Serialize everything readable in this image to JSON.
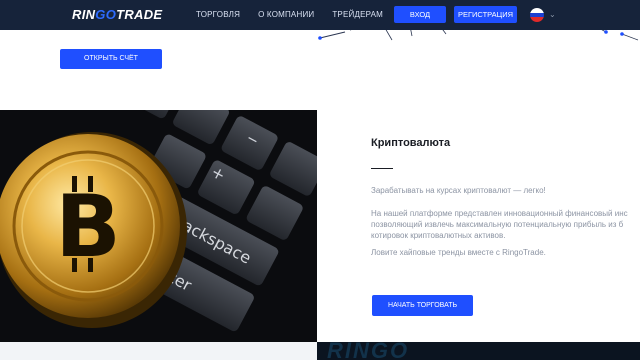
{
  "header": {
    "logo": {
      "part1": "RIN",
      "part2": "GO",
      "part3": "TRADE"
    },
    "nav": [
      {
        "label": "ТОРГОВЛЯ"
      },
      {
        "label": "О КОМПАНИИ"
      },
      {
        "label": "ТРЕЙДЕРАМ"
      }
    ],
    "login_label": "ВХОД",
    "register_label": "РЕГИСТРАЦИЯ",
    "language_flag": [
      "#ffffff",
      "#1c3fd1",
      "#e02a2a"
    ],
    "language_chevron": "⌄"
  },
  "hero": {
    "open_account_label": "ОТКРЫТЬ СЧЁТ"
  },
  "section": {
    "title": "Криптовалюта",
    "paragraph1": "Зарабатывать на курсах криптовалют — легко!",
    "paragraph2_line1": "На нашей платформе представлен инновационный финансовый инс",
    "paragraph2_line2": "позволяющий извлечь максимальную потенциальную прибыль из б",
    "paragraph2_line3": "котировок криптовалютных активов.",
    "paragraph3": "Ловите хайповые тренды вместе с RingoTrade.",
    "cta_label": "НАЧАТЬ ТОРГОВАТЬ",
    "image": {
      "coin_icon": "bitcoin-coin",
      "key_backspace": "Backspace",
      "key_enter": "Enter"
    }
  },
  "footer_strip": {
    "brand_text": "RINGO"
  },
  "colors": {
    "header_bg": "#16233a",
    "accent": "#1f4fff",
    "text_dark": "#1a1d24",
    "text_muted": "#8c94a3"
  }
}
